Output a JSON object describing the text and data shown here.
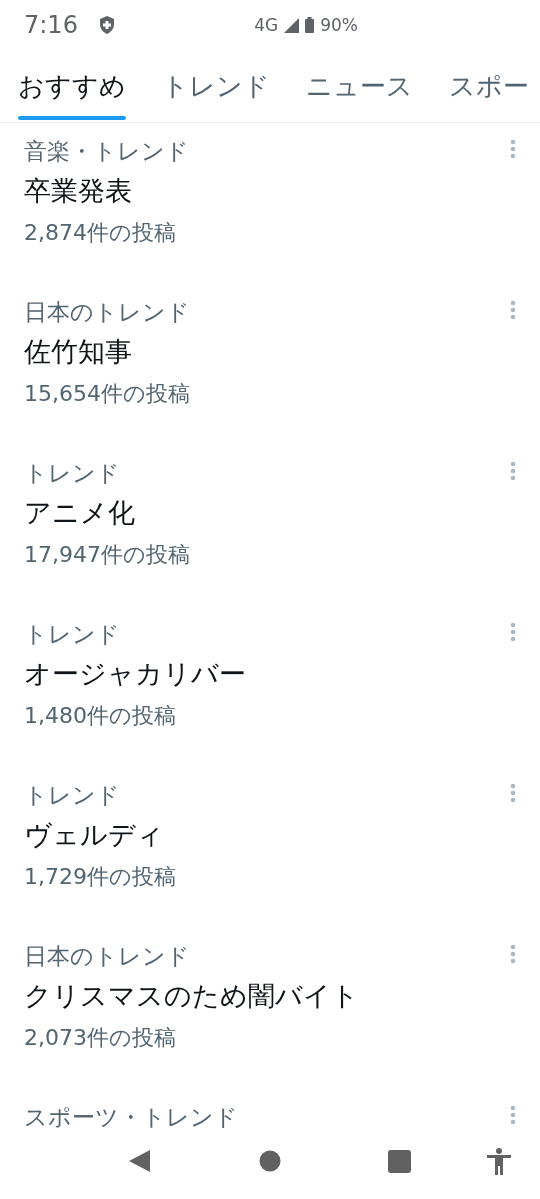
{
  "status_bar": {
    "time": "7:16",
    "network": "4G",
    "battery": "90%"
  },
  "tabs": [
    {
      "label": "おすすめ",
      "selected": true
    },
    {
      "label": "トレンド",
      "selected": false
    },
    {
      "label": "ニュース",
      "selected": false
    },
    {
      "label": "スポー",
      "selected": false
    }
  ],
  "trends": [
    {
      "category": "音楽・トレンド",
      "title": "卒業発表",
      "posts": "2,874件の投稿"
    },
    {
      "category": "日本のトレンド",
      "title": "佐竹知事",
      "posts": "15,654件の投稿"
    },
    {
      "category": "トレンド",
      "title": "アニメ化",
      "posts": "17,947件の投稿"
    },
    {
      "category": "トレンド",
      "title": "オージャカリバー",
      "posts": "1,480件の投稿"
    },
    {
      "category": "トレンド",
      "title": "ヴェルディ",
      "posts": "1,729件の投稿"
    },
    {
      "category": "日本のトレンド",
      "title": "クリスマスのため闇バイト",
      "posts": "2,073件の投稿"
    },
    {
      "category": "スポーツ・トレンド"
    }
  ]
}
